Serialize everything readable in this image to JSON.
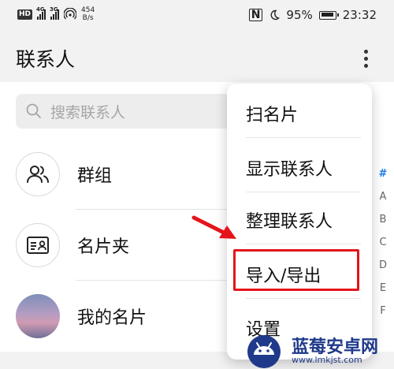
{
  "status_bar": {
    "hd": "HD",
    "net1": "4G",
    "net2": "3G",
    "speed_value": "454",
    "speed_unit": "B/s",
    "nfc": "N",
    "battery_percent": "95%",
    "time": "23:32"
  },
  "header": {
    "title": "联系人"
  },
  "search": {
    "placeholder": "搜索联系人"
  },
  "list": [
    {
      "label": "群组",
      "icon": "group-icon"
    },
    {
      "label": "名片夹",
      "icon": "card-holder-icon"
    },
    {
      "label": "我的名片",
      "icon": "avatar"
    }
  ],
  "index_bar": [
    "#",
    "A",
    "B",
    "C",
    "D",
    "E",
    "F"
  ],
  "menu": {
    "items": [
      "扫名片",
      "显示联系人",
      "整理联系人",
      "导入/导出",
      "设置"
    ],
    "highlighted": "导入/导出"
  },
  "watermark": {
    "title": "蓝莓安卓网",
    "url": "www.lmkjst.com"
  },
  "colors": {
    "highlight": "#e5141b",
    "index_active": "#1a7bea",
    "watermark": "#1f3a8a"
  }
}
